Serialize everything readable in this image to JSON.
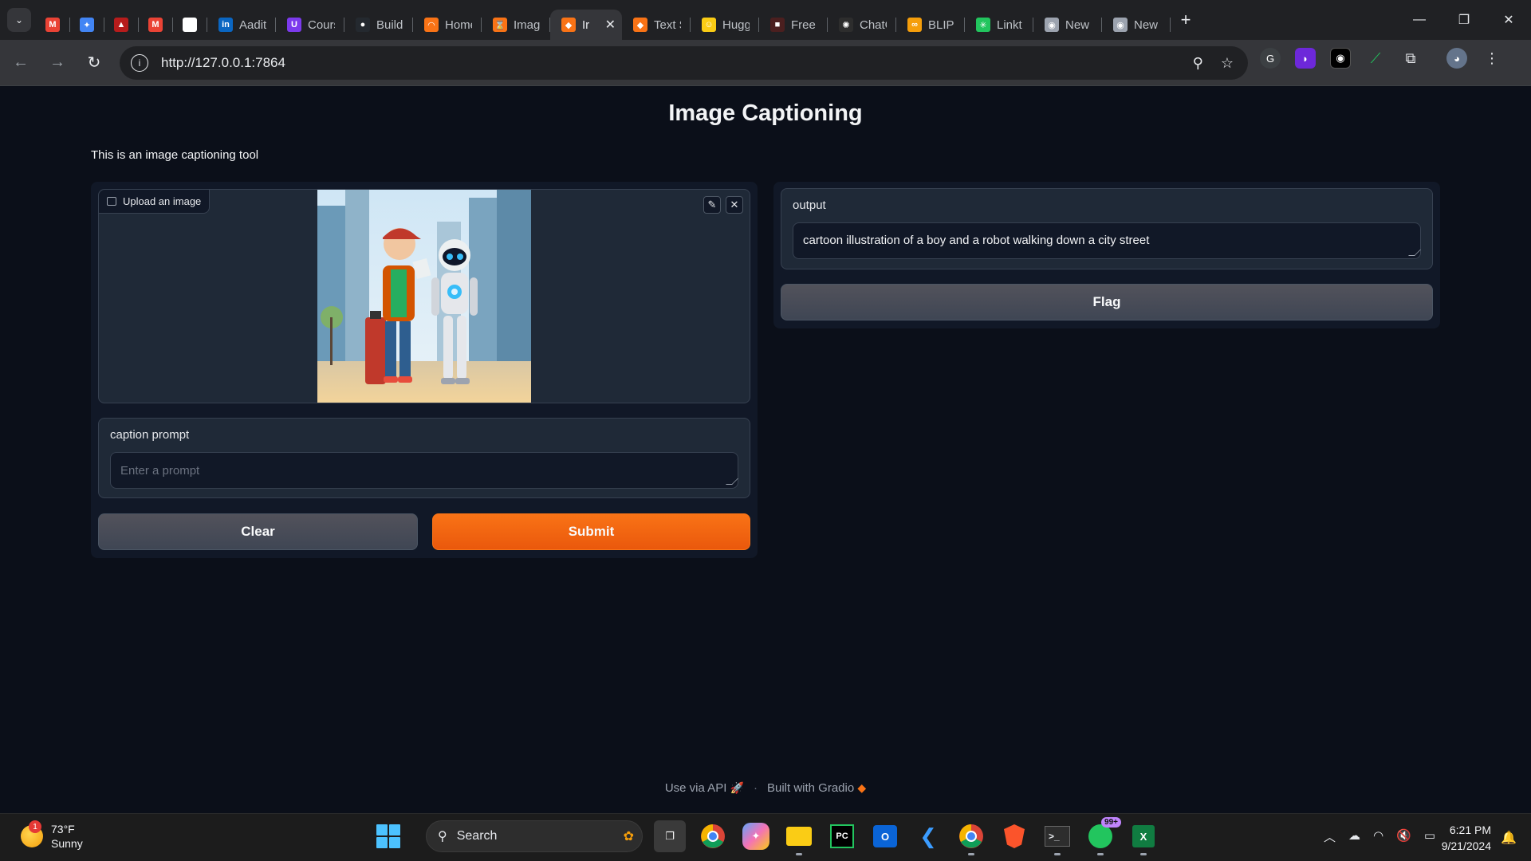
{
  "browser": {
    "tabs": [
      {
        "title": "",
        "icon": "gmail-icon",
        "color": "#ea4335",
        "glyph": "M"
      },
      {
        "title": "",
        "icon": "gemini-icon",
        "color": "#4285f4",
        "glyph": "✦"
      },
      {
        "title": "",
        "icon": "site-icon",
        "color": "#b71c1c",
        "glyph": "▲"
      },
      {
        "title": "",
        "icon": "gmail-icon",
        "color": "#ea4335",
        "glyph": "M"
      },
      {
        "title": "",
        "icon": "calendar-icon",
        "color": "#ffffff",
        "glyph": "▦"
      },
      {
        "title": "Aadit",
        "icon": "linkedin-icon",
        "color": "#0a66c2",
        "glyph": "in"
      },
      {
        "title": "Cours",
        "icon": "course-icon",
        "color": "#7c3aed",
        "glyph": "U"
      },
      {
        "title": "Build",
        "icon": "github-icon",
        "color": "#24292f",
        "glyph": "●"
      },
      {
        "title": "Home",
        "icon": "home-icon",
        "color": "#f97316",
        "glyph": "◠"
      },
      {
        "title": "Imag",
        "icon": "hourglass-icon",
        "color": "#f97316",
        "glyph": "⌛"
      },
      {
        "title": "Ir",
        "icon": "gradio-icon",
        "color": "#f97316",
        "glyph": "◆"
      },
      {
        "title": "Text S",
        "icon": "gradio-icon",
        "color": "#f97316",
        "glyph": "◆"
      },
      {
        "title": "Hugg",
        "icon": "huggingface-icon",
        "color": "#facc15",
        "glyph": "☺"
      },
      {
        "title": "Free I",
        "icon": "site-icon",
        "color": "#4b1f1f",
        "glyph": "■"
      },
      {
        "title": "ChatG",
        "icon": "openai-icon",
        "color": "#2d2d2d",
        "glyph": "✺"
      },
      {
        "title": "BLIP I",
        "icon": "meta-icon",
        "color": "#f59e0b",
        "glyph": "∞"
      },
      {
        "title": "Linkt",
        "icon": "linktree-icon",
        "color": "#22c55e",
        "glyph": "✳"
      },
      {
        "title": "New",
        "icon": "chrome-icon",
        "color": "#9ca3af",
        "glyph": "◉"
      },
      {
        "title": "New",
        "icon": "chrome-icon",
        "color": "#9ca3af",
        "glyph": "◉"
      }
    ],
    "active_tab_index": 10,
    "url": "http://127.0.0.1:7864"
  },
  "app": {
    "title": "Image Captioning",
    "description": "This is an image captioning tool",
    "image_input": {
      "label": "Upload an image"
    },
    "caption_prompt": {
      "label": "caption prompt",
      "placeholder": "Enter a prompt",
      "value": ""
    },
    "buttons": {
      "clear": "Clear",
      "submit": "Submit",
      "flag": "Flag"
    },
    "output": {
      "label": "output",
      "value": "cartoon illustration of a boy and a robot walking down a city street"
    },
    "colors": {
      "accent": "#f97316",
      "background": "#0b0f19",
      "panel": "#1f2937"
    }
  },
  "footer": {
    "api_link": "Use via API",
    "separator": "·",
    "built_with": "Built with Gradio"
  },
  "taskbar": {
    "weather": {
      "temp": "73°F",
      "condition": "Sunny",
      "badge": "1"
    },
    "search_label": "Search",
    "whatsapp_badge": "99+",
    "time": "6:21 PM",
    "date": "9/21/2024"
  }
}
